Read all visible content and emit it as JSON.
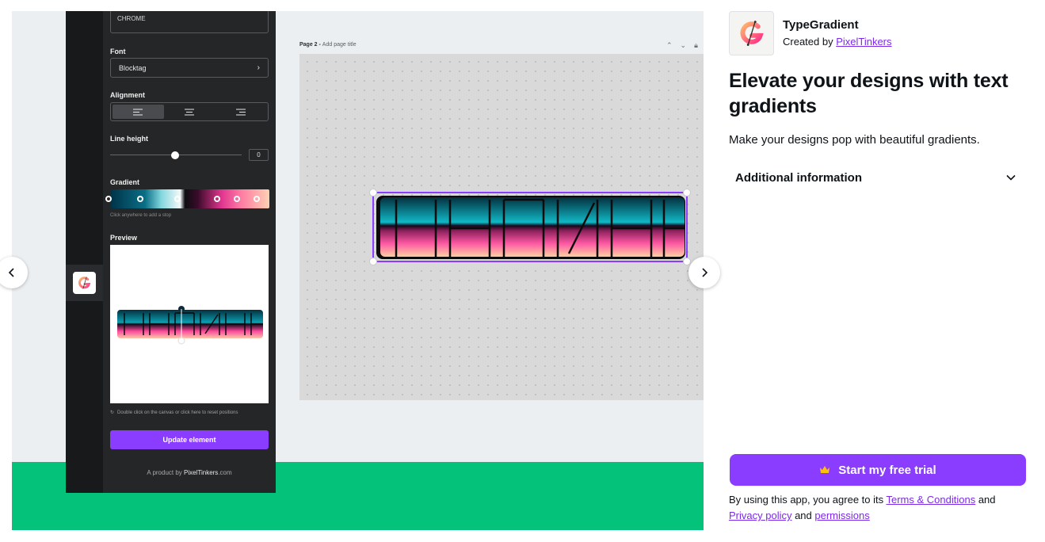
{
  "gallery": {
    "editor": {
      "text_value": "CHROME",
      "font_label": "Font",
      "font_value": "Blocktag",
      "alignment_label": "Alignment",
      "line_height_label": "Line height",
      "line_height_value": "0",
      "gradient_label": "Gradient",
      "gradient_hint": "Click anywhere to add a stop",
      "preview_label": "Preview",
      "reset_hint": "Double click on the canvas or click here to reset positions",
      "update_button": "Update element",
      "product_by_prefix": "A product by ",
      "product_by_name": "PixelTinkers",
      "product_by_suffix": ".com",
      "page_title_prefix": "Page 2 - ",
      "page_title_placeholder": "Add page title"
    },
    "prev_icon": "chevron-left-icon",
    "next_icon": "chevron-right-icon"
  },
  "app": {
    "name": "TypeGradient",
    "created_by_prefix": "Created by ",
    "creator": "PixelTinkers",
    "headline": "Elevate your designs with text gradients",
    "tagline": "Make your designs pop with beautiful gradients.",
    "additional_info": "Additional information",
    "cta_label": "Start my free trial",
    "terms_prefix": "By using this app, you agree to its ",
    "terms_link": "Terms & Conditions",
    "terms_and": " and",
    "privacy_link": "Privacy policy",
    "terms_and2": " and ",
    "permissions_link": "permissions"
  },
  "colors": {
    "accent": "#8b3dff",
    "link": "#7d2ae8",
    "gallery_bg": "#04c27a"
  }
}
